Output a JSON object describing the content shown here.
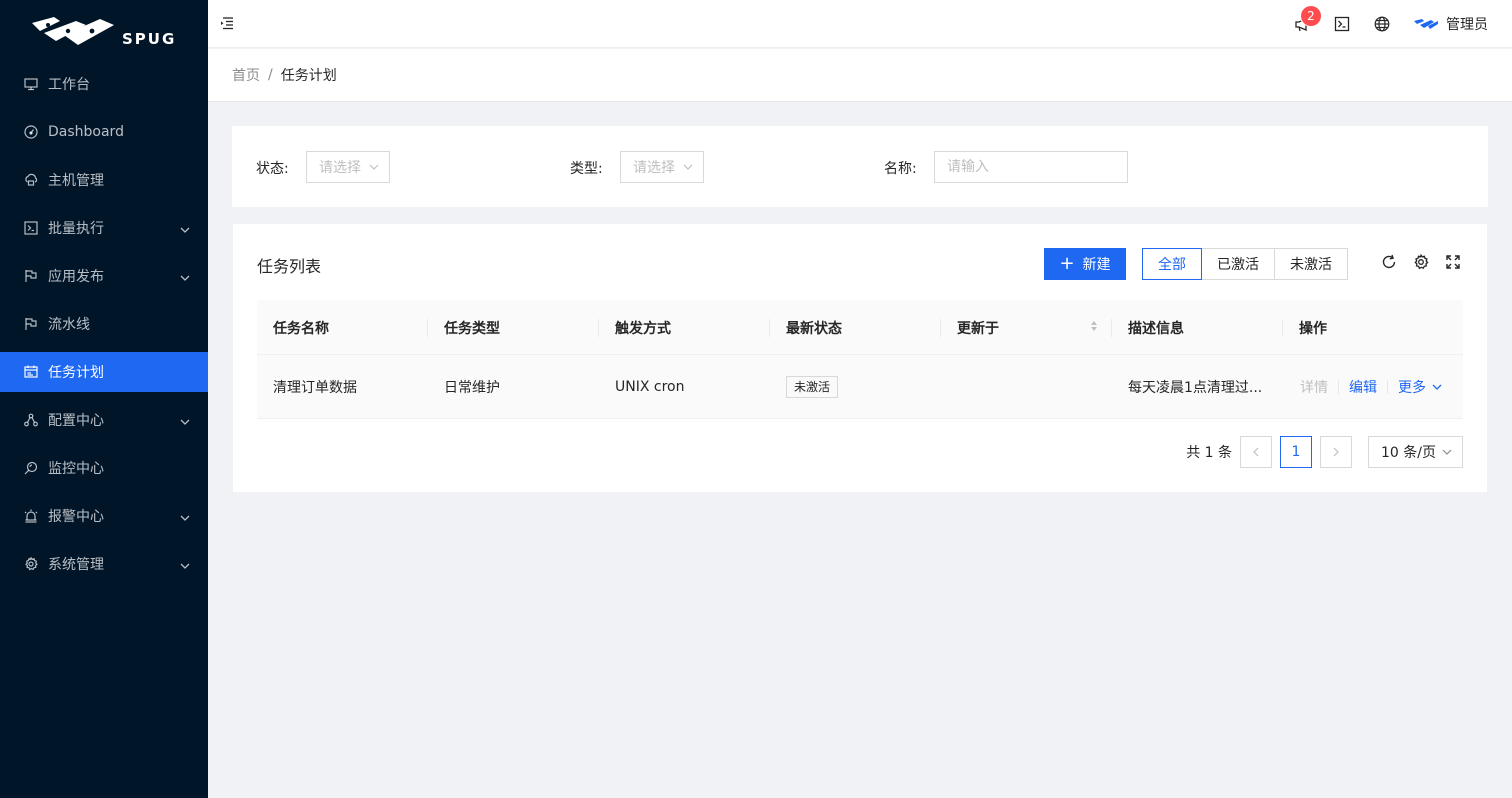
{
  "app": {
    "logo_text": "SPUG"
  },
  "sidebar": {
    "items": [
      {
        "label": "工作台",
        "icon": "desktop-icon",
        "has_arrow": false,
        "active": false
      },
      {
        "label": "Dashboard",
        "icon": "dashboard-icon",
        "has_arrow": false,
        "active": false
      },
      {
        "label": "主机管理",
        "icon": "cloud-server-icon",
        "has_arrow": false,
        "active": false
      },
      {
        "label": "批量执行",
        "icon": "code-icon",
        "has_arrow": true,
        "active": false
      },
      {
        "label": "应用发布",
        "icon": "flag-icon",
        "has_arrow": true,
        "active": false
      },
      {
        "label": "流水线",
        "icon": "flag-icon",
        "has_arrow": false,
        "active": false
      },
      {
        "label": "任务计划",
        "icon": "schedule-icon",
        "has_arrow": false,
        "active": true
      },
      {
        "label": "配置中心",
        "icon": "deployment-unit-icon",
        "has_arrow": true,
        "active": false
      },
      {
        "label": "监控中心",
        "icon": "monitor-icon",
        "has_arrow": false,
        "active": false
      },
      {
        "label": "报警中心",
        "icon": "alert-icon",
        "has_arrow": true,
        "active": false
      },
      {
        "label": "系统管理",
        "icon": "setting-icon",
        "has_arrow": true,
        "active": false
      }
    ]
  },
  "header": {
    "notification_count": "2",
    "user_name": "管理员"
  },
  "breadcrumb": {
    "home": "首页",
    "separator": "/",
    "current": "任务计划"
  },
  "filters": {
    "status_label": "状态:",
    "status_placeholder": "请选择",
    "type_label": "类型:",
    "type_placeholder": "请选择",
    "name_label": "名称:",
    "name_placeholder": "请输入"
  },
  "table_card": {
    "title": "任务列表",
    "new_button": "新建",
    "segments": [
      "全部",
      "已激活",
      "未激活"
    ],
    "selected_segment": "全部",
    "columns": [
      "任务名称",
      "任务类型",
      "触发方式",
      "最新状态",
      "更新于",
      "描述信息",
      "操作"
    ],
    "rows": [
      {
        "name": "清理订单数据",
        "type": "日常维护",
        "trigger": "UNIX cron",
        "status": "未激活",
        "updated": "",
        "description": "每天凌晨1点清理过...",
        "actions": {
          "detail": "详情",
          "edit": "编辑",
          "more": "更多"
        }
      }
    ],
    "pagination": {
      "total_text": "共 1 条",
      "current_page": "1",
      "page_size": "10 条/页"
    }
  },
  "colors": {
    "primary": "#1f68f1",
    "sidebar_bg": "#011529",
    "badge": "#ff4d4f"
  }
}
